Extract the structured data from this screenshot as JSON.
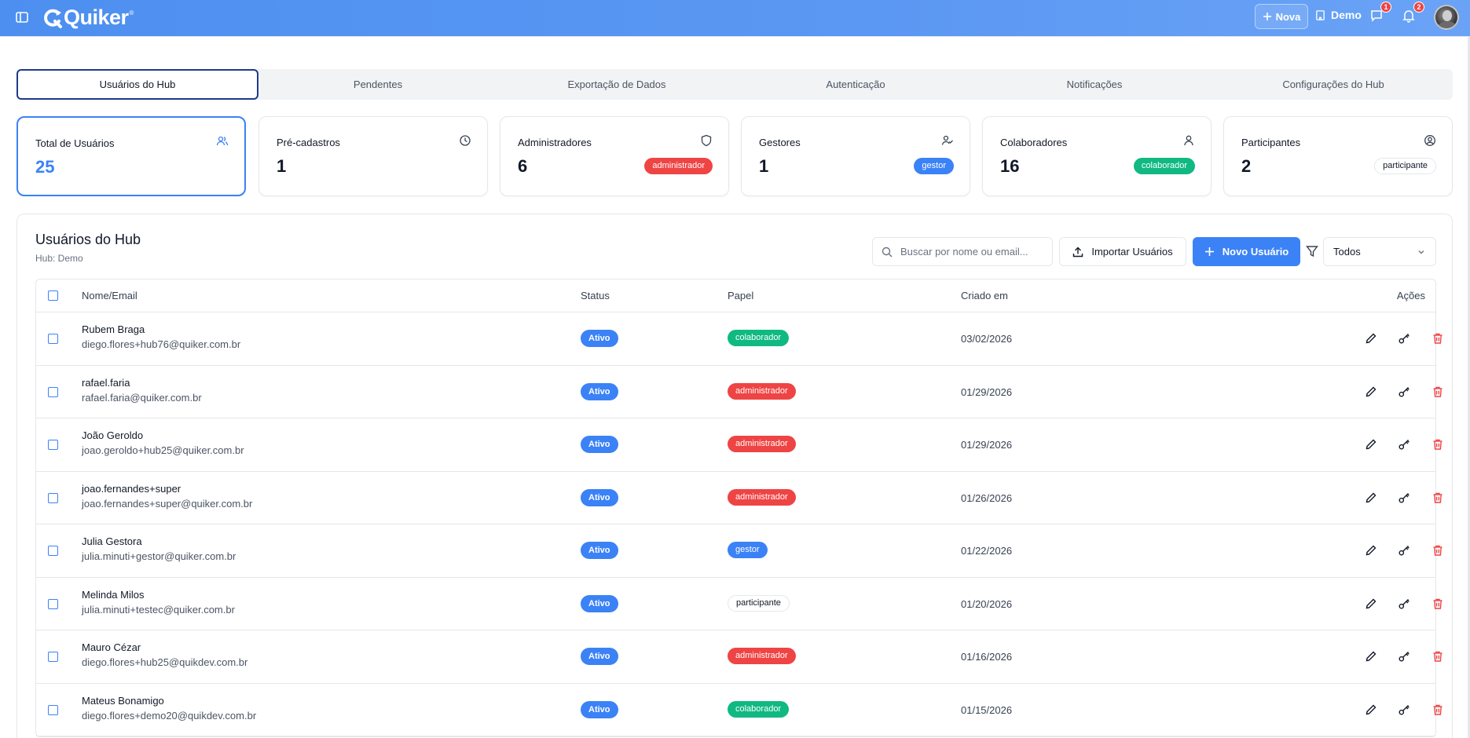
{
  "header": {
    "logo_text": "Quiker",
    "logo_reg": "®",
    "nova_label": "Nova",
    "hub_label": "Demo",
    "messages_badge": "1",
    "notifications_badge": "2"
  },
  "tabs": [
    {
      "label": "Usuários do Hub",
      "active": true
    },
    {
      "label": "Pendentes",
      "active": false
    },
    {
      "label": "Exportação de Dados",
      "active": false
    },
    {
      "label": "Autenticação",
      "active": false
    },
    {
      "label": "Notificações",
      "active": false
    },
    {
      "label": "Configurações do Hub",
      "active": false
    }
  ],
  "stats": [
    {
      "label": "Total de Usuários",
      "value": "25",
      "icon": "users-icon"
    },
    {
      "label": "Pré-cadastros",
      "value": "1",
      "icon": "clock-icon"
    },
    {
      "label": "Administradores",
      "value": "6",
      "icon": "shield-icon",
      "badge": "administrador"
    },
    {
      "label": "Gestores",
      "value": "1",
      "icon": "user-check-icon",
      "badge": "gestor"
    },
    {
      "label": "Colaboradores",
      "value": "16",
      "icon": "user-icon",
      "badge": "colaborador"
    },
    {
      "label": "Participantes",
      "value": "2",
      "icon": "user-circle-icon",
      "badge": "participante"
    }
  ],
  "panel": {
    "title": "Usuários do Hub",
    "subtitle": "Hub: Demo",
    "search_placeholder": "Buscar por nome ou email...",
    "import_label": "Importar Usuários",
    "new_user_label": "Novo Usuário",
    "filter_value": "Todos"
  },
  "table": {
    "columns": {
      "name": "Nome/Email",
      "status": "Status",
      "role": "Papel",
      "created": "Criado em",
      "actions": "Ações"
    },
    "rows": [
      {
        "name": "Rubem Braga",
        "email": "diego.flores+hub76@quiker.com.br",
        "status": "Ativo",
        "role": "colaborador",
        "created": "03/02/2026"
      },
      {
        "name": "rafael.faria",
        "email": "rafael.faria@quiker.com.br",
        "status": "Ativo",
        "role": "administrador",
        "created": "01/29/2026"
      },
      {
        "name": "João Geroldo",
        "email": "joao.geroldo+hub25@quiker.com.br",
        "status": "Ativo",
        "role": "administrador",
        "created": "01/29/2026"
      },
      {
        "name": "joao.fernandes+super",
        "email": "joao.fernandes+super@quiker.com.br",
        "status": "Ativo",
        "role": "administrador",
        "created": "01/26/2026"
      },
      {
        "name": "Julia Gestora",
        "email": "julia.minuti+gestor@quiker.com.br",
        "status": "Ativo",
        "role": "gestor",
        "created": "01/22/2026"
      },
      {
        "name": "Melinda Milos",
        "email": "julia.minuti+testec@quiker.com.br",
        "status": "Ativo",
        "role": "participante",
        "created": "01/20/2026"
      },
      {
        "name": "Mauro Cézar",
        "email": "diego.flores+hub25@quikdev.com.br",
        "status": "Ativo",
        "role": "administrador",
        "created": "01/16/2026"
      },
      {
        "name": "Mateus Bonamigo",
        "email": "diego.flores+demo20@quikdev.com.br",
        "status": "Ativo",
        "role": "colaborador",
        "created": "01/15/2026"
      }
    ]
  },
  "colors": {
    "header": "#5b98f3",
    "primary": "#3b82f6",
    "admin": "#ef4444",
    "colaborador": "#10b981",
    "delete": "#ef4444"
  }
}
